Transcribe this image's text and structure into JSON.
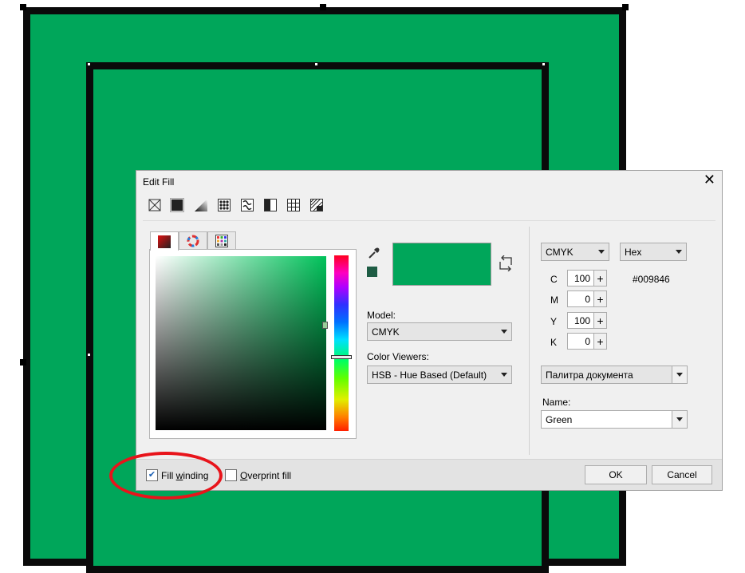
{
  "dialog": {
    "title": "Edit Fill",
    "close_glyph": "✕",
    "fill_type_buttons": [
      "no-fill-icon",
      "uniform-fill-icon",
      "fountain-fill-icon",
      "vector-pattern-icon",
      "bitmap-pattern-icon",
      "two-color-pattern-icon",
      "texture-fill-icon",
      "postscript-fill-icon"
    ],
    "selected_fill_type": "uniform-fill-icon",
    "viewer_tabs": [
      "color-viewer-tab",
      "color-harmonies-tab",
      "color-palettes-tab"
    ],
    "model_label": "Model:",
    "model_value": "CMYK",
    "viewers_label": "Color Viewers:",
    "viewers_value": "HSB - Hue Based (Default)",
    "right": {
      "colorspace_value": "CMYK",
      "format_value": "Hex",
      "hex_value": "#009846",
      "channels": [
        {
          "label": "C",
          "value": "100"
        },
        {
          "label": "M",
          "value": "0"
        },
        {
          "label": "Y",
          "value": "100"
        },
        {
          "label": "K",
          "value": "0"
        }
      ],
      "palette_value": "Палитра документа",
      "name_label": "Name:",
      "name_value": "Green"
    },
    "footer": {
      "fill_winding_pre": "Fill ",
      "fill_winding_accel": "w",
      "fill_winding_post": "inding",
      "fill_winding_checked": true,
      "overprint_accel": "O",
      "overprint_post": "verprint fill",
      "overprint_checked": false,
      "ok_label": "OK",
      "cancel_label": "Cancel"
    }
  },
  "colors": {
    "current_swatch": "#00a65a",
    "previous_swatch": "#1e5c44",
    "canvas_fill": "#00a65a",
    "outline": "#0a0a0a",
    "highlight_ellipse": "#e8141b"
  }
}
